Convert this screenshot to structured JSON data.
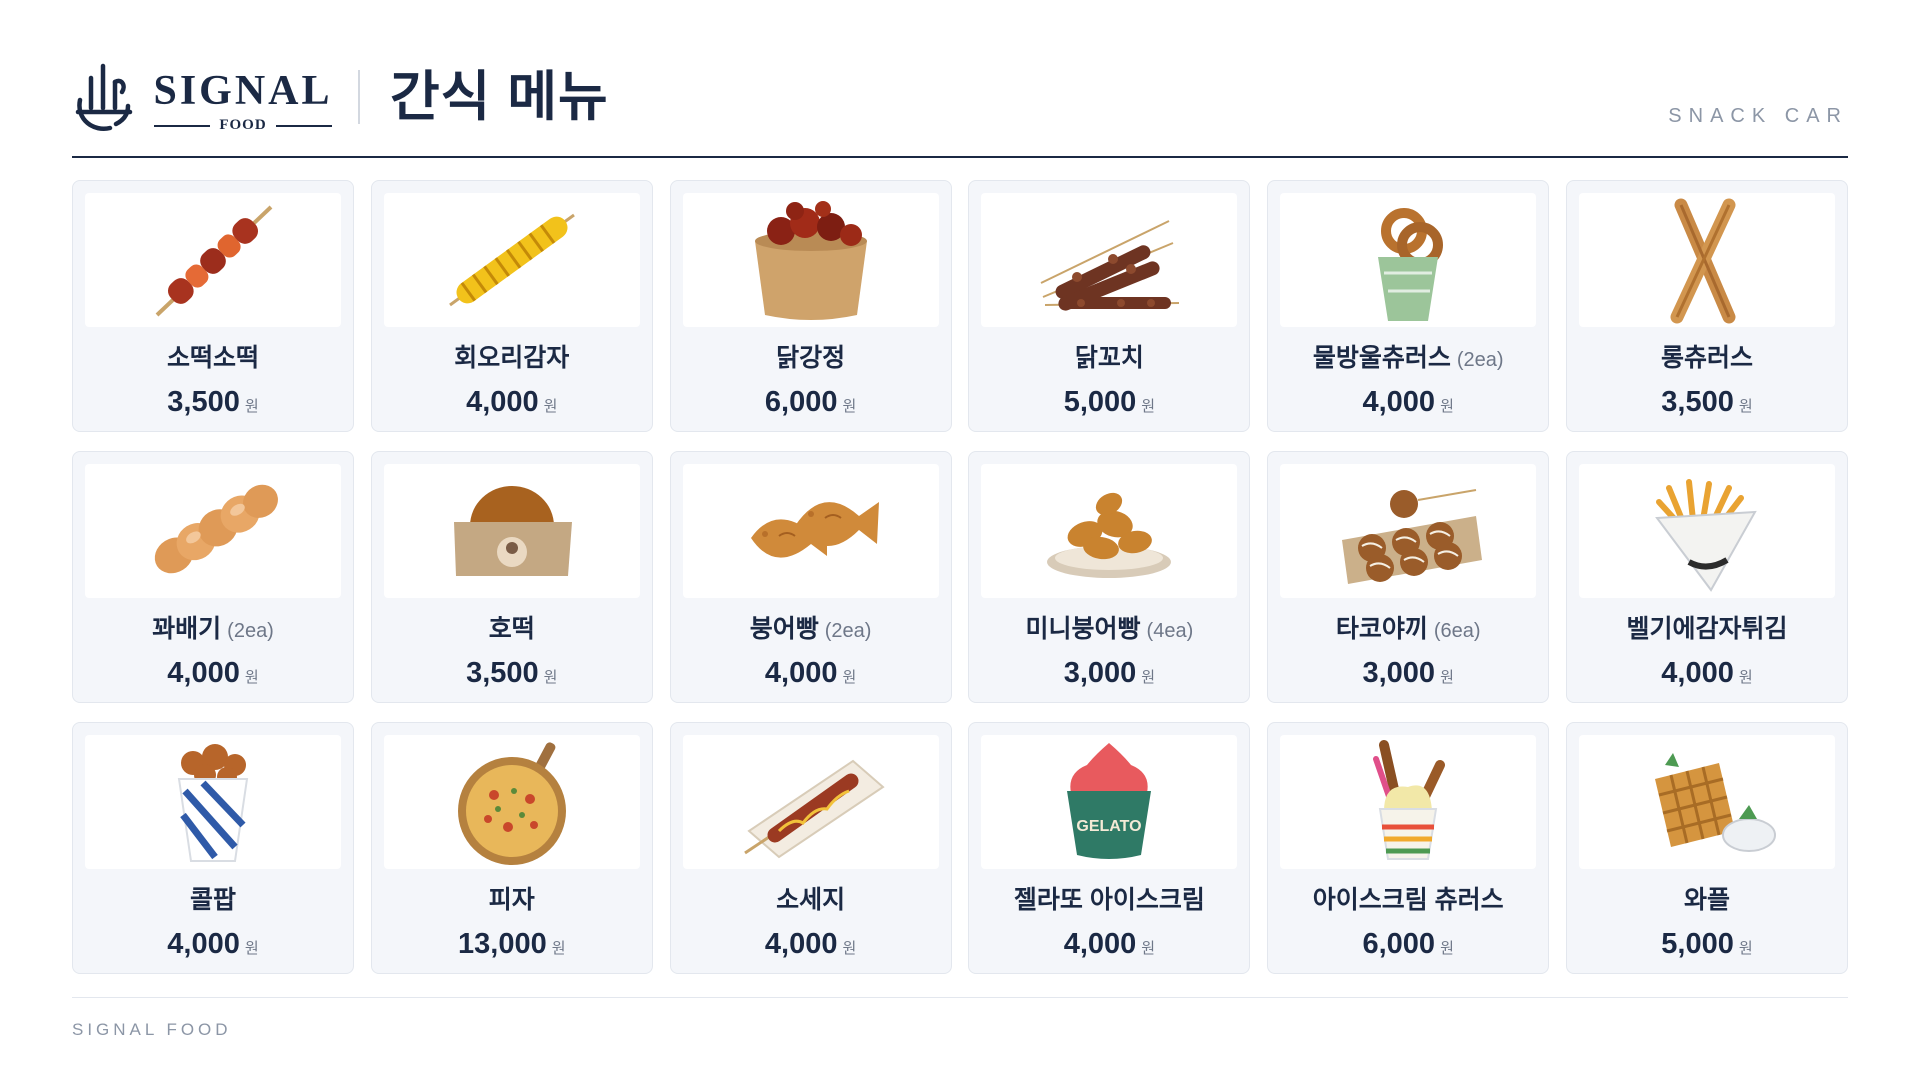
{
  "brand": {
    "name": "SIGNAL",
    "sub": "FOOD"
  },
  "header": {
    "title": "간식 메뉴",
    "subtitle": "SNACK CAR"
  },
  "currency": "원",
  "items": [
    {
      "name": "소떡소떡",
      "qty": "",
      "price": "3,500",
      "icon": "sotteok-skewer-icon"
    },
    {
      "name": "회오리감자",
      "qty": "",
      "price": "4,000",
      "icon": "tornado-potato-icon"
    },
    {
      "name": "닭강정",
      "qty": "",
      "price": "6,000",
      "icon": "chicken-bites-cup-icon"
    },
    {
      "name": "닭꼬치",
      "qty": "",
      "price": "5,000",
      "icon": "chicken-skewers-icon"
    },
    {
      "name": "물방울츄러스",
      "qty": "(2ea)",
      "price": "4,000",
      "icon": "ring-churros-cup-icon"
    },
    {
      "name": "롱츄러스",
      "qty": "",
      "price": "3,500",
      "icon": "long-churros-icon"
    },
    {
      "name": "꽈배기",
      "qty": "(2ea)",
      "price": "4,000",
      "icon": "twisted-donut-icon"
    },
    {
      "name": "호떡",
      "qty": "",
      "price": "3,500",
      "icon": "hotteok-icon"
    },
    {
      "name": "붕어빵",
      "qty": "(2ea)",
      "price": "4,000",
      "icon": "fish-bread-icon"
    },
    {
      "name": "미니붕어빵",
      "qty": "(4ea)",
      "price": "3,000",
      "icon": "mini-fish-bread-plate-icon"
    },
    {
      "name": "타코야끼",
      "qty": "(6ea)",
      "price": "3,000",
      "icon": "takoyaki-tray-icon"
    },
    {
      "name": "벨기에감자튀김",
      "qty": "",
      "price": "4,000",
      "icon": "belgian-fries-cone-icon"
    },
    {
      "name": "콜팝",
      "qty": "",
      "price": "4,000",
      "icon": "colpop-cup-icon"
    },
    {
      "name": "피자",
      "qty": "",
      "price": "13,000",
      "icon": "pizza-board-icon"
    },
    {
      "name": "소세지",
      "qty": "",
      "price": "4,000",
      "icon": "sausage-tray-icon"
    },
    {
      "name": "젤라또 아이스크림",
      "qty": "",
      "price": "4,000",
      "icon": "gelato-cup-icon",
      "label": "GELATO"
    },
    {
      "name": "아이스크림 츄러스",
      "qty": "",
      "price": "6,000",
      "icon": "icecream-churros-icon"
    },
    {
      "name": "와플",
      "qty": "",
      "price": "5,000",
      "icon": "waffle-icon"
    }
  ],
  "footer": {
    "text": "SIGNAL FOOD"
  }
}
